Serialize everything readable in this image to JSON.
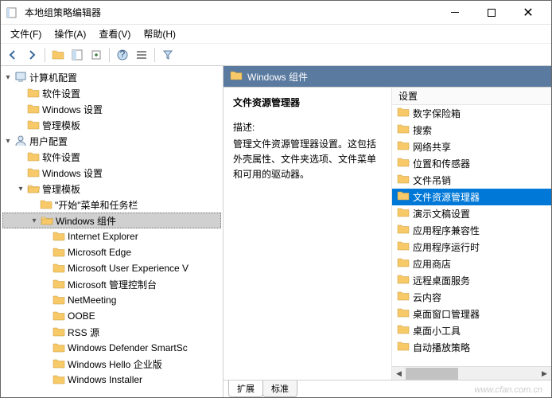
{
  "window": {
    "title": "本地组策略编辑器"
  },
  "menubar": {
    "file": "文件(F)",
    "action": "操作(A)",
    "view": "查看(V)",
    "help": "帮助(H)"
  },
  "tree": {
    "root": {
      "pc": {
        "label": "计算机配置",
        "expanded": true,
        "children": {
          "soft": {
            "label": "软件设置"
          },
          "win": {
            "label": "Windows 设置"
          },
          "admin": {
            "label": "管理模板"
          }
        }
      },
      "user": {
        "label": "用户配置",
        "expanded": true,
        "children": {
          "soft": {
            "label": "软件设置"
          },
          "win": {
            "label": "Windows 设置"
          },
          "admin": {
            "label": "管理模板",
            "expanded": true,
            "children": {
              "start": {
                "label": "\"开始\"菜单和任务栏"
              },
              "wincomp": {
                "label": "Windows 组件",
                "expanded": true,
                "selected": true,
                "children": {
                  "ie": {
                    "label": "Internet Explorer"
                  },
                  "edge": {
                    "label": "Microsoft Edge"
                  },
                  "mue": {
                    "label": "Microsoft User Experience V"
                  },
                  "mmc": {
                    "label": "Microsoft 管理控制台"
                  },
                  "netm": {
                    "label": "NetMeeting"
                  },
                  "oobe": {
                    "label": "OOBE"
                  },
                  "rss": {
                    "label": "RSS 源"
                  },
                  "wds": {
                    "label": "Windows Defender SmartSc"
                  },
                  "whe": {
                    "label": "Windows Hello 企业版"
                  },
                  "winst": {
                    "label": "Windows Installer"
                  }
                }
              }
            }
          }
        }
      }
    }
  },
  "right": {
    "header": "Windows 组件",
    "detail": {
      "title": "文件资源管理器",
      "subtitle": "描述:",
      "text": "管理文件资源管理器设置。这包括外壳属性、文件夹选项、文件菜单和可用的驱动器。"
    },
    "list_header": "设置",
    "items": [
      {
        "label": "数字保险箱"
      },
      {
        "label": "搜索"
      },
      {
        "label": "网络共享"
      },
      {
        "label": "位置和传感器"
      },
      {
        "label": "文件吊销"
      },
      {
        "label": "文件资源管理器",
        "selected": true
      },
      {
        "label": "演示文稿设置"
      },
      {
        "label": "应用程序兼容性"
      },
      {
        "label": "应用程序运行时"
      },
      {
        "label": "应用商店"
      },
      {
        "label": "远程桌面服务"
      },
      {
        "label": "云内容"
      },
      {
        "label": "桌面窗口管理器"
      },
      {
        "label": "桌面小工具"
      },
      {
        "label": "自动播放策略"
      }
    ]
  },
  "tabs": {
    "ext": "扩展",
    "std": "标准"
  },
  "watermark": "www.cfan.com.cn"
}
